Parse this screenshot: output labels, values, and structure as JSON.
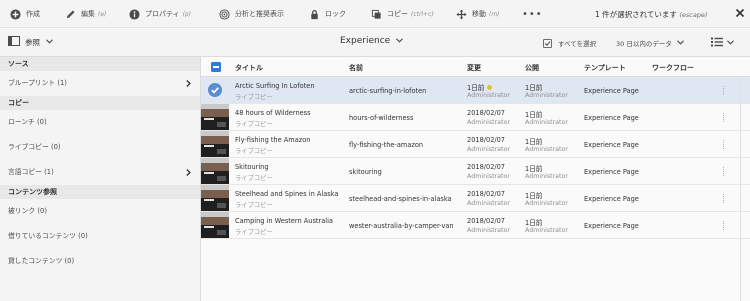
{
  "actions": [
    {
      "id": "create",
      "label": "作成",
      "shortcut": "",
      "icon": "plus-circle-icon"
    },
    {
      "id": "edit",
      "label": "編集",
      "shortcut": "(e)",
      "icon": "pencil-icon"
    },
    {
      "id": "properties",
      "label": "プロパティ",
      "shortcut": "(p)",
      "icon": "info-icon"
    },
    {
      "id": "analytics",
      "label": "分析と推奨表示",
      "shortcut": "",
      "icon": "target-icon"
    },
    {
      "id": "lock",
      "label": "ロック",
      "shortcut": "",
      "icon": "lock-icon"
    },
    {
      "id": "copy",
      "label": "コピー",
      "shortcut": "(ctrl+c)",
      "icon": "copy-icon"
    },
    {
      "id": "move",
      "label": "移動",
      "shortcut": "(m)",
      "icon": "move-icon"
    }
  ],
  "more_label": "•••",
  "selection": {
    "text": "1 件が選択されています",
    "shortcut": "(escape)"
  },
  "toolbar": {
    "rail_label": "参照",
    "collection_title": "Experience",
    "select_all": "すべてを選択",
    "date_filter": "30 日以内のデータ"
  },
  "rail": {
    "sections": [
      {
        "title": "ソース",
        "items": [
          {
            "label": "ブループリント (1)",
            "arrow": true
          }
        ]
      },
      {
        "title": "コピー",
        "items": [
          {
            "label": "ローンチ (0)",
            "arrow": false
          },
          {
            "label": "ライブコピー (0)",
            "arrow": false
          },
          {
            "label": "言語コピー (1)",
            "arrow": true
          }
        ]
      },
      {
        "title": "コンテンツ参照",
        "items": [
          {
            "label": "被リンク (0)",
            "arrow": false
          },
          {
            "label": "借りているコンテンツ (0)",
            "arrow": false
          },
          {
            "label": "貸したコンテンツ (0)",
            "arrow": false
          }
        ]
      }
    ]
  },
  "table": {
    "headers": {
      "title": "タイトル",
      "name": "名前",
      "modified": "変更",
      "published": "公開",
      "template": "テンプレート",
      "workflow": "ワークフロー"
    },
    "rows": [
      {
        "title": "Arctic Surfing In Lofoten",
        "sub": "ライブコピー",
        "name": "arctic-surfing-in-lofoten",
        "modified": "1日前",
        "modified_dot": true,
        "modified_by": "Administrator",
        "published": "1日前",
        "published_by": "Administrator",
        "template": "Experience Page",
        "selected": true
      },
      {
        "title": "48 hours of Wilderness",
        "sub": "ライブコピー",
        "name": "hours-of-wilderness",
        "modified": "2018/02/07",
        "modified_dot": false,
        "modified_by": "Administrator",
        "published": "1日前",
        "published_by": "Administrator",
        "template": "Experience Page",
        "selected": false
      },
      {
        "title": "Fly-fishing the Amazon",
        "sub": "ライブコピー",
        "name": "fly-fishing-the-amazon",
        "modified": "2018/02/07",
        "modified_dot": false,
        "modified_by": "Administrator",
        "published": "1日前",
        "published_by": "Administrator",
        "template": "Experience Page",
        "selected": false
      },
      {
        "title": "Skitouring",
        "sub": "ライブコピー",
        "name": "skitouring",
        "modified": "2018/02/07",
        "modified_dot": false,
        "modified_by": "Administrator",
        "published": "1日前",
        "published_by": "Administrator",
        "template": "Experience Page",
        "selected": false
      },
      {
        "title": "Steelhead and Spines in Alaska",
        "sub": "ライブコピー",
        "name": "steelhead-and-spines-in-alaska",
        "modified": "2018/02/07",
        "modified_dot": false,
        "modified_by": "Administrator",
        "published": "1日前",
        "published_by": "Administrator",
        "template": "Experience Page",
        "selected": false
      },
      {
        "title": "Camping in Western Australia",
        "sub": "ライブコピー",
        "name": "wester-australia-by-camper-van",
        "modified": "2018/02/07",
        "modified_dot": false,
        "modified_by": "Administrator",
        "published": "1日前",
        "published_by": "Administrator",
        "template": "Experience Page",
        "selected": false
      }
    ]
  },
  "colors": {
    "accent": "#2d7be0",
    "selected_row": "#dfe7f3",
    "status_dot": "#e8c11b"
  }
}
